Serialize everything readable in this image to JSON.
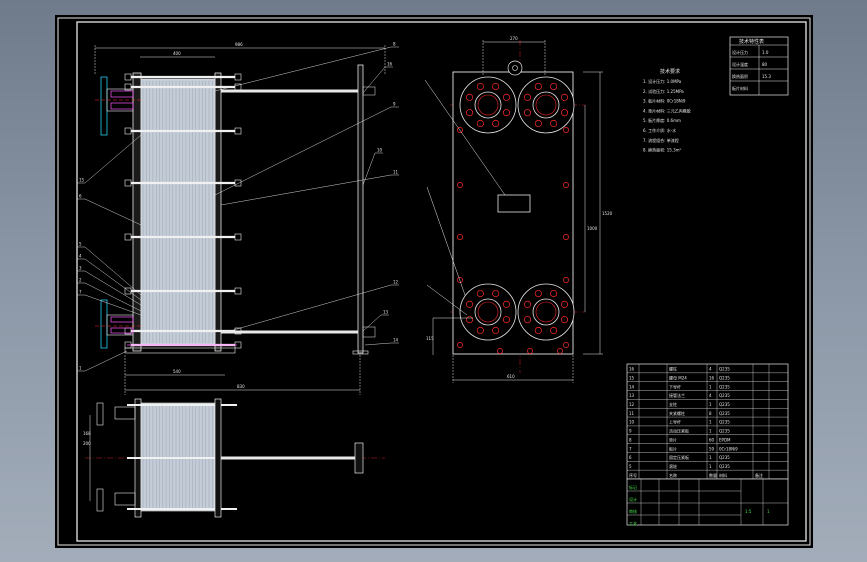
{
  "drawing": {
    "colors": {
      "background": "#000000",
      "frame": "#e8e8e8",
      "plate": "#b8c0cc",
      "bolt": "#f0f0f0",
      "flange_red": "#ff2a2a",
      "magenta": "#ff55ff",
      "cyan": "#22d3ee",
      "green_text": "#46e04a"
    },
    "tech_table": {
      "title": "技术特性表",
      "rows": [
        {
          "k": "设计压力",
          "v": "1.0"
        },
        {
          "k": "设计温度",
          "v": "80"
        },
        {
          "k": "换热面积",
          "v": "15.3"
        },
        {
          "k": "板片材料",
          "v": ""
        }
      ]
    },
    "tech_req": {
      "title": "技术要求",
      "lines": [
        "1. 设计压力: 1.0MPa",
        "2. 试验压力: 1.25MPa",
        "3. 板片材料: 0Cr18Ni9",
        "4. 垫片材料: 三元乙丙橡胶",
        "5. 板片厚度: 0.6mm",
        "6. 工作介质: 水-水",
        "7. 流程组合: 单流程",
        "8. 换热面积: 15.3m²"
      ]
    },
    "part_labels": [
      "8",
      "9",
      "10",
      "11",
      "12",
      "13",
      "14",
      "6",
      "5",
      "4",
      "3",
      "2",
      "1",
      "7",
      "15",
      "16"
    ],
    "bom": {
      "rows": [
        {
          "no": "16",
          "name": "螺柱",
          "qty": "4",
          "mat": "Q235"
        },
        {
          "no": "15",
          "name": "螺母 M24",
          "qty": "16",
          "mat": "Q235"
        },
        {
          "no": "14",
          "name": "下导杆",
          "qty": "1",
          "mat": "Q235"
        },
        {
          "no": "13",
          "name": "接管法兰",
          "qty": "4",
          "mat": "Q235"
        },
        {
          "no": "12",
          "name": "支柱",
          "qty": "1",
          "mat": "Q235"
        },
        {
          "no": "11",
          "name": "夹紧螺柱",
          "qty": "8",
          "mat": "Q235"
        },
        {
          "no": "10",
          "name": "上导杆",
          "qty": "1",
          "mat": "Q235"
        },
        {
          "no": "9",
          "name": "活动压紧板",
          "qty": "1",
          "mat": "Q235"
        },
        {
          "no": "8",
          "name": "垫片",
          "qty": "60",
          "mat": "EPDM"
        },
        {
          "no": "7",
          "name": "板片",
          "qty": "59",
          "mat": "0Cr18Ni9"
        },
        {
          "no": "6",
          "name": "固定压紧板",
          "qty": "1",
          "mat": "Q235"
        },
        {
          "no": "5",
          "name": "滚轮",
          "qty": "1",
          "mat": "Q235"
        }
      ],
      "header": [
        "序号",
        "名称",
        "数量",
        "材料",
        "备注"
      ]
    },
    "title_block": {
      "rows": [
        "标记",
        "设计",
        "审核",
        "工艺"
      ],
      "scale": "1:5",
      "sheet": "1"
    }
  }
}
